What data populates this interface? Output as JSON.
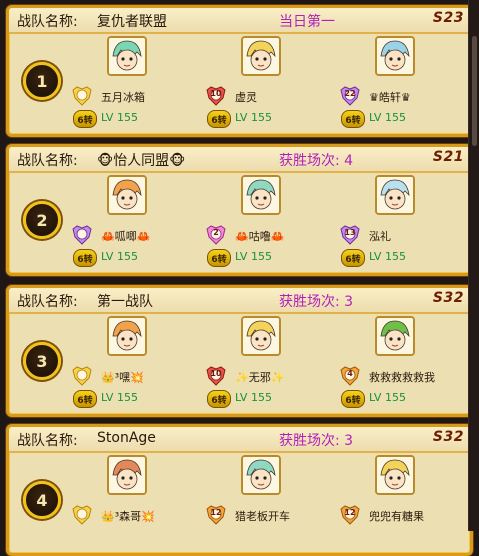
{
  "colors": {
    "frame": "#d79a1a",
    "card_bg": "#ecdfb2",
    "status_purple": "#b322b8",
    "level_green": "#17923a",
    "server_tag": "#6b1e00",
    "rank_circle_border": "#f1c21b"
  },
  "team_label": "战队名称:",
  "teams": [
    {
      "rank": "1",
      "name": "复仇者联盟",
      "status": "当日第一",
      "server": "S23",
      "members": [
        {
          "nickname": "五月冰箱",
          "level": "LV 155",
          "rebirth": "6转",
          "emblem": "gold-rank-emblem-icon",
          "emblem_num": "",
          "avatar_hair": "#7ad7b3"
        },
        {
          "nickname": "虚灵",
          "level": "LV 155",
          "rebirth": "6转",
          "emblem": "red-rank-10-emblem-icon",
          "emblem_num": "10",
          "avatar_hair": "#f4d35a"
        },
        {
          "nickname": "♛皓轩♛",
          "level": "LV 155",
          "rebirth": "6转",
          "emblem": "purple-rank-22-emblem-icon",
          "emblem_num": "22",
          "avatar_hair": "#9ad2e8"
        }
      ]
    },
    {
      "rank": "2",
      "name": "🐵怡人同盟🐵",
      "status": "获胜场次: 4",
      "server": "S21",
      "members": [
        {
          "nickname": "🦀呱唧🦀",
          "level": "LV 155",
          "rebirth": "6转",
          "emblem": "purple-rank-emblem-icon",
          "emblem_num": "",
          "avatar_hair": "#f2a24a"
        },
        {
          "nickname": "🦀咕噜🦀",
          "level": "LV 155",
          "rebirth": "6转",
          "emblem": "pink-rank-2-emblem-icon",
          "emblem_num": "2",
          "avatar_hair": "#8fd8c2"
        },
        {
          "nickname": "泓礼",
          "level": "LV 155",
          "rebirth": "6转",
          "emblem": "purple-rank-13-emblem-icon",
          "emblem_num": "13",
          "avatar_hair": "#b9e0f0"
        }
      ]
    },
    {
      "rank": "3",
      "name": "第一战队",
      "status": "获胜场次: 3",
      "server": "S32",
      "members": [
        {
          "nickname": "👑³嘿💥",
          "level": "LV 155",
          "rebirth": "6转",
          "emblem": "gold-rank-emblem-icon",
          "emblem_num": "",
          "avatar_hair": "#f2a24a"
        },
        {
          "nickname": "✨无邪✨",
          "level": "LV 155",
          "rebirth": "6转",
          "emblem": "red-rank-10-emblem-icon",
          "emblem_num": "10",
          "avatar_hair": "#f4d35a"
        },
        {
          "nickname": "救救救救救我",
          "level": "LV 155",
          "rebirth": "6转",
          "emblem": "orange-rank-4-emblem-icon",
          "emblem_num": "4",
          "avatar_hair": "#6fbf4a"
        }
      ]
    },
    {
      "rank": "4",
      "name": "StonAge",
      "status": "获胜场次: 3",
      "server": "S32",
      "members": [
        {
          "nickname": "👑³森哥💥",
          "level": "",
          "rebirth": "",
          "emblem": "gold-rank-emblem-icon",
          "emblem_num": "",
          "avatar_hair": "#e4885a"
        },
        {
          "nickname": "猎老板开车",
          "level": "",
          "rebirth": "",
          "emblem": "orange-rank-12-emblem-icon",
          "emblem_num": "12",
          "avatar_hair": "#8fd8c2"
        },
        {
          "nickname": "兜兜有糖果",
          "level": "",
          "rebirth": "",
          "emblem": "orange-rank-12-emblem-icon",
          "emblem_num": "12",
          "avatar_hair": "#f4d35a"
        }
      ]
    }
  ]
}
